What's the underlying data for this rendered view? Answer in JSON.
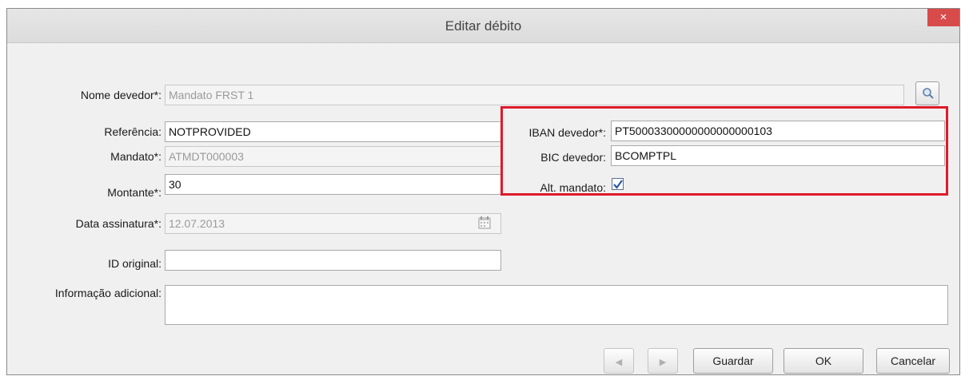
{
  "window": {
    "title": "Editar débito",
    "close_glyph": "×"
  },
  "form": {
    "nome_devedor": {
      "label": "Nome devedor*:",
      "value": "Mandato FRST 1"
    },
    "referencia": {
      "label": "Referência:",
      "value": "NOTPROVIDED"
    },
    "mandato": {
      "label": "Mandato*:",
      "value": "ATMDT000003"
    },
    "montante": {
      "label": "Montante*:",
      "value": "30"
    },
    "data_assinatura": {
      "label": "Data assinatura*:",
      "value": "12.07.2013"
    },
    "id_original": {
      "label": "ID original:",
      "value": ""
    },
    "informacao_adicional": {
      "label": "Informação adicional:",
      "value": ""
    },
    "iban_devedor": {
      "label": "IBAN devedor*:",
      "value": "PT50003300000000000000103"
    },
    "bic_devedor": {
      "label": "BIC devedor:",
      "value": "BCOMPTPL"
    },
    "alt_mandato": {
      "label": "Alt. mandato:",
      "checked": true
    }
  },
  "buttons": {
    "prev": "◀",
    "next": "▶",
    "guardar": "Guardar",
    "ok": "OK",
    "cancelar": "Cancelar"
  },
  "icons": {
    "search": "search-icon",
    "calendar": "calendar-icon",
    "check": "checkmark-icon"
  },
  "colors": {
    "highlight": "#e0192a",
    "close": "#d84b4b"
  }
}
